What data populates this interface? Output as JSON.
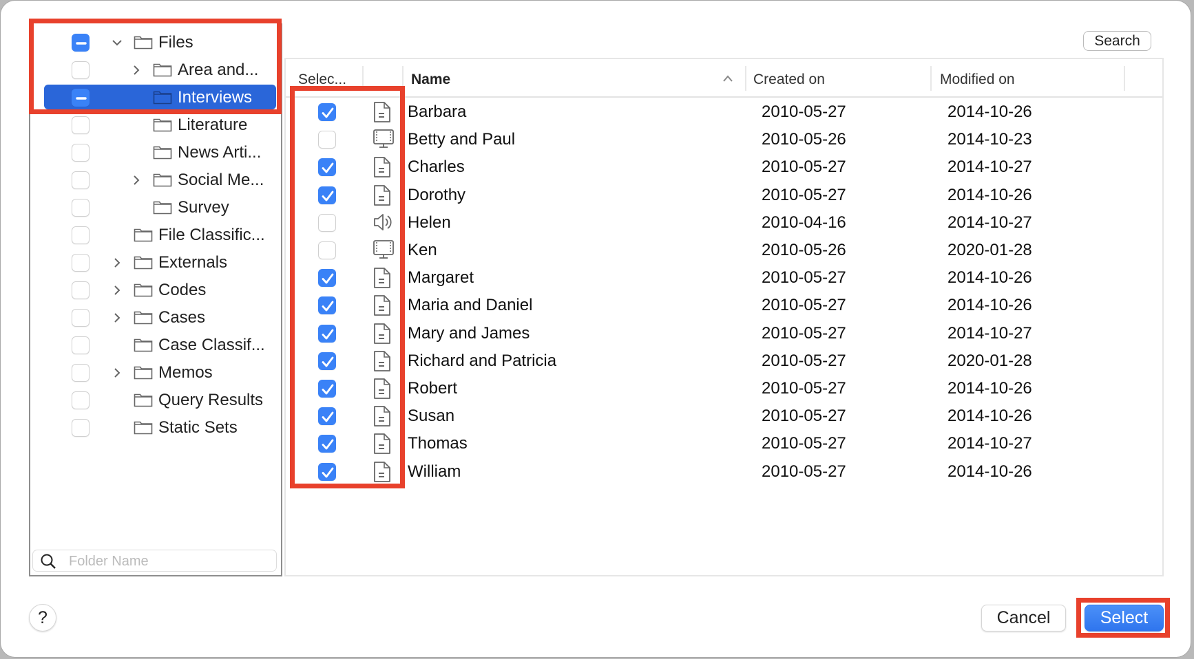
{
  "tree": {
    "items": [
      {
        "label": "Files",
        "level": 0,
        "expander": "expanded",
        "check": "mixed",
        "selected": false
      },
      {
        "label": "Area and...",
        "level": 1,
        "expander": "collapsed",
        "check": "off",
        "selected": false
      },
      {
        "label": "Interviews",
        "level": 1,
        "expander": "none",
        "check": "mixed",
        "selected": true
      },
      {
        "label": "Literature",
        "level": 1,
        "expander": "none",
        "check": "off",
        "selected": false
      },
      {
        "label": "News Arti...",
        "level": 1,
        "expander": "none",
        "check": "off",
        "selected": false
      },
      {
        "label": "Social Me...",
        "level": 1,
        "expander": "collapsed",
        "check": "off",
        "selected": false
      },
      {
        "label": "Survey",
        "level": 1,
        "expander": "none",
        "check": "off",
        "selected": false
      },
      {
        "label": "File Classific...",
        "level": 0,
        "expander": "none",
        "check": "off",
        "selected": false
      },
      {
        "label": "Externals",
        "level": 0,
        "expander": "collapsed",
        "check": "off",
        "selected": false
      },
      {
        "label": "Codes",
        "level": 0,
        "expander": "collapsed",
        "check": "off",
        "selected": false
      },
      {
        "label": "Cases",
        "level": 0,
        "expander": "collapsed",
        "check": "off",
        "selected": false
      },
      {
        "label": "Case Classif...",
        "level": 0,
        "expander": "none",
        "check": "off",
        "selected": false
      },
      {
        "label": "Memos",
        "level": 0,
        "expander": "collapsed",
        "check": "off",
        "selected": false
      },
      {
        "label": "Query Results",
        "level": 0,
        "expander": "none",
        "check": "off",
        "selected": false
      },
      {
        "label": "Static Sets",
        "level": 0,
        "expander": "none",
        "check": "off",
        "selected": false
      }
    ],
    "search_placeholder": "Folder Name"
  },
  "search_button": "Search",
  "table": {
    "headers": {
      "select": "Selec...",
      "name": "Name",
      "created": "Created on",
      "modified": "Modified on"
    },
    "sort": "name-ascending",
    "rows": [
      {
        "checked": true,
        "icon": "document-icon",
        "name": "Barbara",
        "created": "2010-05-27",
        "modified": "2014-10-26"
      },
      {
        "checked": false,
        "icon": "video-icon",
        "name": "Betty and Paul",
        "created": "2010-05-26",
        "modified": "2014-10-23"
      },
      {
        "checked": true,
        "icon": "document-icon",
        "name": "Charles",
        "created": "2010-05-27",
        "modified": "2014-10-27"
      },
      {
        "checked": true,
        "icon": "document-icon",
        "name": "Dorothy",
        "created": "2010-05-27",
        "modified": "2014-10-26"
      },
      {
        "checked": false,
        "icon": "audio-icon",
        "name": "Helen",
        "created": "2010-04-16",
        "modified": "2014-10-27"
      },
      {
        "checked": false,
        "icon": "video-icon",
        "name": "Ken",
        "created": "2010-05-26",
        "modified": "2020-01-28"
      },
      {
        "checked": true,
        "icon": "document-icon",
        "name": "Margaret",
        "created": "2010-05-27",
        "modified": "2014-10-26"
      },
      {
        "checked": true,
        "icon": "document-icon",
        "name": "Maria and Daniel",
        "created": "2010-05-27",
        "modified": "2014-10-26"
      },
      {
        "checked": true,
        "icon": "document-icon",
        "name": "Mary and James",
        "created": "2010-05-27",
        "modified": "2014-10-27"
      },
      {
        "checked": true,
        "icon": "document-icon",
        "name": "Richard and Patricia",
        "created": "2010-05-27",
        "modified": "2020-01-28"
      },
      {
        "checked": true,
        "icon": "document-icon",
        "name": "Robert",
        "created": "2010-05-27",
        "modified": "2014-10-26"
      },
      {
        "checked": true,
        "icon": "document-icon",
        "name": "Susan",
        "created": "2010-05-27",
        "modified": "2014-10-26"
      },
      {
        "checked": true,
        "icon": "document-icon",
        "name": "Thomas",
        "created": "2010-05-27",
        "modified": "2014-10-27"
      },
      {
        "checked": true,
        "icon": "document-icon",
        "name": "William",
        "created": "2010-05-27",
        "modified": "2014-10-26"
      }
    ]
  },
  "footer": {
    "help": "?",
    "cancel": "Cancel",
    "select": "Select"
  },
  "colors": {
    "accent": "#3a82f7",
    "selection": "#2a66d9",
    "annotation": "#e8412c"
  }
}
